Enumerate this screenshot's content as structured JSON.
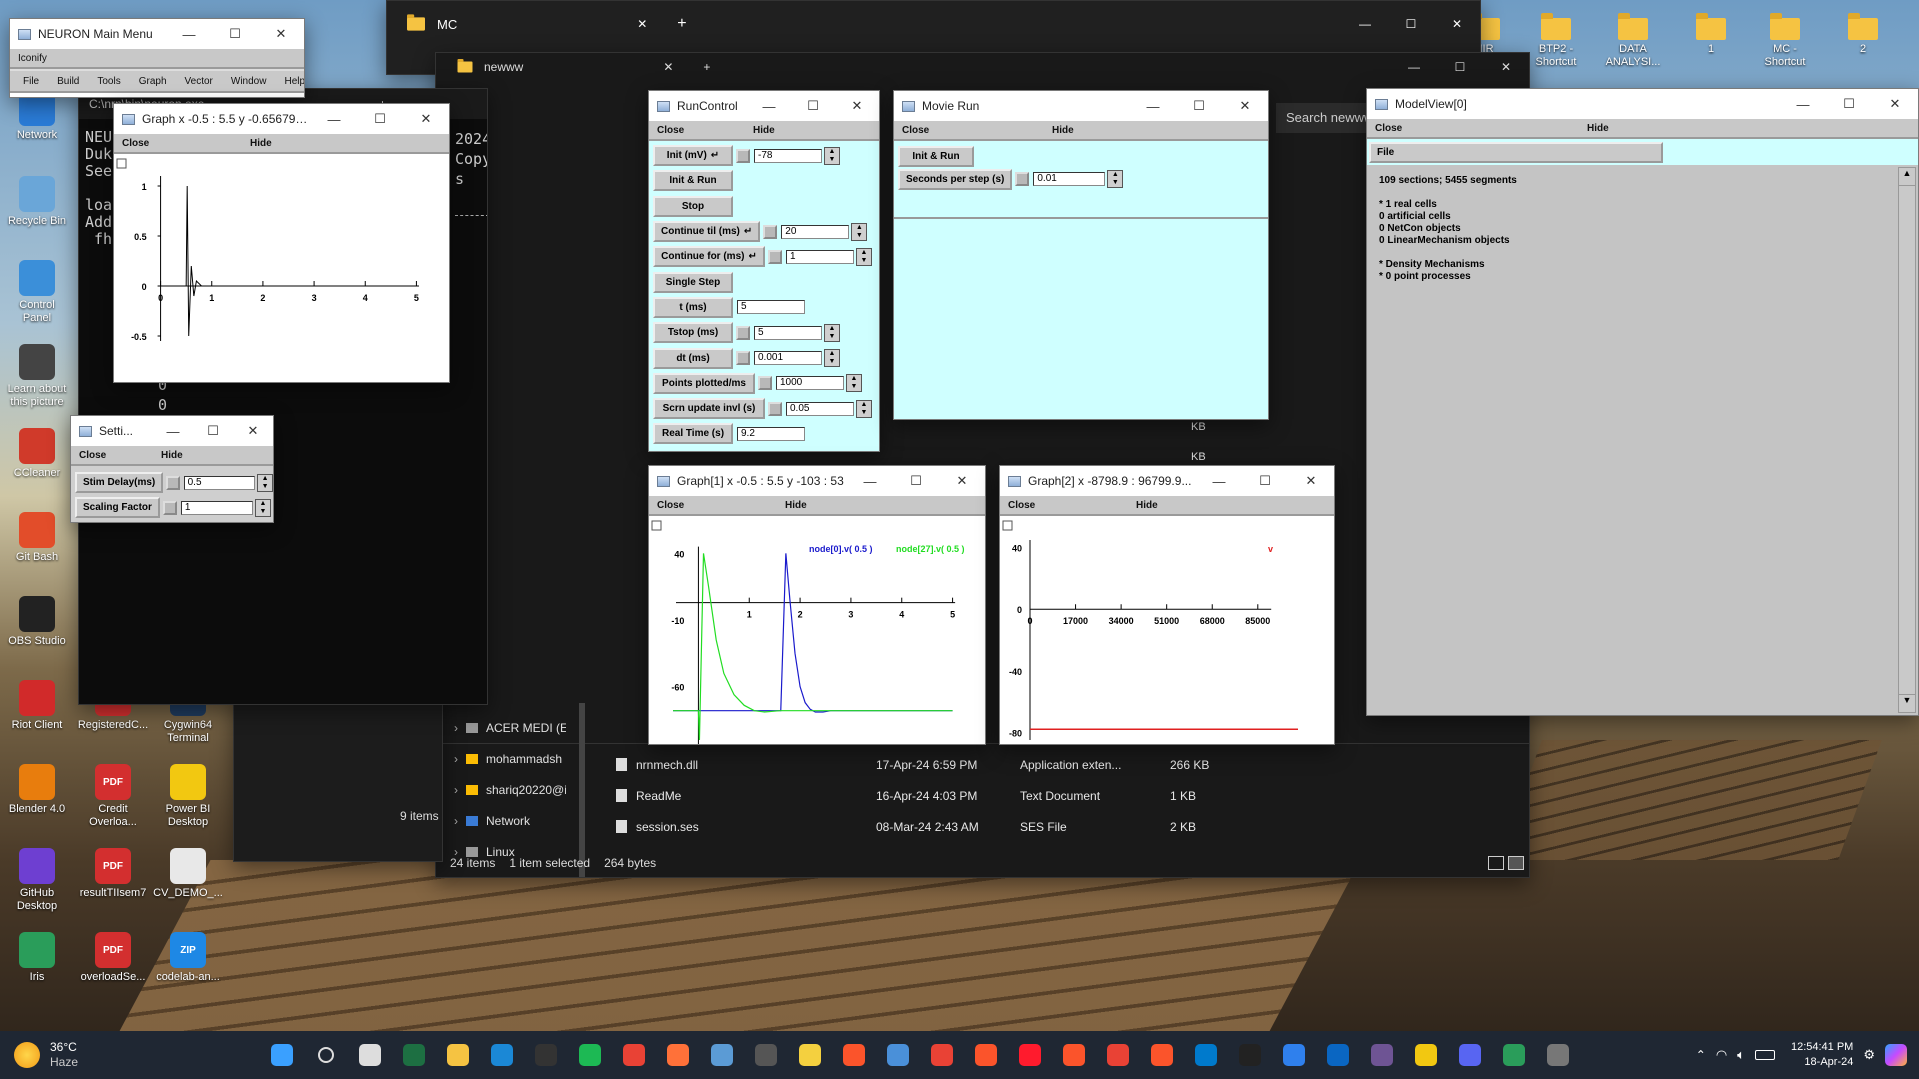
{
  "desktop": {
    "left_icons": [
      {
        "label": "Network",
        "icon": "network-icon"
      },
      {
        "label": "Recycle Bin",
        "icon": "recycle-bin-icon"
      },
      {
        "label": "Control Panel",
        "icon": "control-panel-icon"
      },
      {
        "label": "Learn about this picture",
        "icon": "camera-icon"
      },
      {
        "label": "CCleaner",
        "icon": "ccleaner-icon"
      },
      {
        "label": "Git Bash",
        "icon": "git-icon"
      },
      {
        "label": "OBS Studio",
        "icon": "obs-icon"
      },
      {
        "label": "Riot Client",
        "icon": "riot-icon"
      },
      {
        "label": "Blender 4.0",
        "icon": "blender-icon"
      },
      {
        "label": "GitHub Desktop",
        "icon": "github-icon"
      },
      {
        "label": "Iris",
        "icon": "iris-icon"
      }
    ],
    "mid_icons": [
      {
        "label": "RegisteredC...",
        "icon": "pdf-icon"
      },
      {
        "label": "Cygwin64 Terminal",
        "icon": "terminal-icon"
      },
      {
        "label": "Credit Overloa...",
        "icon": "pdf-icon"
      },
      {
        "label": "Power BI Desktop",
        "icon": "powerbi-icon"
      },
      {
        "label": "resultTIIsem7",
        "icon": "pdf-icon"
      },
      {
        "label": "CV_DEMO_...",
        "icon": "document-icon"
      },
      {
        "label": "overloadSe...",
        "icon": "pdf-icon"
      },
      {
        "label": "codelab-an...",
        "icon": "zip-icon"
      }
    ],
    "top_right_icons": [
      {
        "label": "IIIR",
        "icon": "folder-icon"
      },
      {
        "label": "BTP2 - Shortcut",
        "icon": "folder-shortcut-icon"
      },
      {
        "label": "DATA ANALYSI...",
        "icon": "folder-shortcut-icon"
      },
      {
        "label": "1",
        "icon": "folder-icon"
      },
      {
        "label": "MC - Shortcut",
        "icon": "folder-shortcut-icon"
      },
      {
        "label": "2",
        "icon": "folder-icon"
      }
    ]
  },
  "mc_window": {
    "title": "MC",
    "tab2_title": "newww",
    "search_placeholder": "Search newww"
  },
  "explorer": {
    "nav": [
      {
        "label": "ACER MEDI (E:",
        "icon": "drive-icon"
      },
      {
        "label": "mohammadsh",
        "icon": "gdrive-icon"
      },
      {
        "label": "shariq20220@i",
        "icon": "gdrive-icon"
      },
      {
        "label": "Network",
        "icon": "network-icon"
      },
      {
        "label": "Linux",
        "icon": "linux-icon"
      }
    ],
    "items_count_side": "9 items",
    "files": [
      {
        "name": "nrnmech.dll",
        "date": "17-Apr-24 6:59 PM",
        "type": "Application exten...",
        "size": "266 KB"
      },
      {
        "name": "ReadMe",
        "date": "16-Apr-24 4:03 PM",
        "type": "Text Document",
        "size": "1 KB"
      },
      {
        "name": "session.ses",
        "date": "08-Mar-24 2:43 AM",
        "type": "SES File",
        "size": "2 KB"
      }
    ],
    "status": {
      "items": "24 items",
      "selected": "1 item selected",
      "bytes": "264 bytes"
    },
    "kb_fragments": [
      "KB",
      "KB"
    ]
  },
  "terminal": {
    "tab_title": "C:\\nrn\\bin\\neuron.exe",
    "lines": [
      "NEU",
      "Duk",
      "See",
      "",
      "loa",
      "Add",
      " fh"
    ],
    "right_lines": [
      "2024-02-09",
      "Copyright 1984-2022",
      "s"
    ],
    "zeros": [
      "0",
      "0"
    ]
  },
  "neuron_main": {
    "title": "NEURON Main Menu",
    "iconify": "Iconify",
    "menu": [
      "File",
      "Build",
      "Tools",
      "Graph",
      "Vector",
      "Window",
      "Help"
    ]
  },
  "graph0": {
    "title": "Graph  x -0.5 : 5.5  y -0.656794...",
    "close": "Close",
    "hide": "Hide",
    "y_ticks": [
      "1",
      "0.5",
      "0",
      "-0.5"
    ],
    "x_ticks": [
      "0",
      "1",
      "2",
      "3",
      "4",
      "5"
    ]
  },
  "settings": {
    "title": "Setti...",
    "close": "Close",
    "hide": "Hide",
    "rows": [
      {
        "label": "Stim Delay(ms)",
        "value": "0.5"
      },
      {
        "label": "Scaling Factor",
        "value": "1"
      }
    ]
  },
  "runcontrol": {
    "title": "RunControl",
    "close": "Close",
    "hide": "Hide",
    "rows": [
      {
        "label": "Init (mV)",
        "arrow": true,
        "value": "-78",
        "check": true,
        "spin": true
      },
      {
        "label": "Init & Run",
        "arrow": false,
        "value": null
      },
      {
        "label": "Stop",
        "arrow": false,
        "value": null
      },
      {
        "label": "Continue til (ms)",
        "arrow": true,
        "value": "20",
        "check": true,
        "spin": true
      },
      {
        "label": "Continue for (ms)",
        "arrow": true,
        "value": "1",
        "check": true,
        "spin": true
      },
      {
        "label": "Single Step",
        "arrow": false,
        "value": null
      },
      {
        "label": "t (ms)",
        "arrow": false,
        "value": "5",
        "check": false,
        "spin": false
      },
      {
        "label": "Tstop (ms)",
        "arrow": false,
        "value": "5",
        "check": true,
        "spin": true
      },
      {
        "label": "dt (ms)",
        "arrow": false,
        "value": "0.001",
        "check": true,
        "spin": true
      },
      {
        "label": "Points plotted/ms",
        "arrow": false,
        "value": "1000",
        "check": true,
        "spin": true
      },
      {
        "label": "Scrn update invl (s)",
        "arrow": false,
        "value": "0.05",
        "check": true,
        "spin": true
      },
      {
        "label": "Real Time (s)",
        "arrow": false,
        "value": "9.2",
        "check": false,
        "spin": false
      }
    ]
  },
  "movierun": {
    "title": "Movie Run",
    "close": "Close",
    "hide": "Hide",
    "init_run": "Init & Run",
    "seconds_label": "Seconds per step (s)",
    "seconds_value": "0.01"
  },
  "modelview": {
    "title": "ModelView[0]",
    "close": "Close",
    "hide": "Hide",
    "file": "File",
    "lines": [
      "109 sections; 5455 segments",
      "",
      "* 1 real cells",
      "0 artificial cells",
      "0 NetCon objects",
      "0 LinearMechanism objects",
      "",
      "* Density Mechanisms",
      "* 0 point processes"
    ]
  },
  "graph1": {
    "title": "Graph[1]  x -0.5 : 5.5  y -103 : 53",
    "close": "Close",
    "hide": "Hide",
    "y_ticks": [
      "40",
      "-10",
      "-60"
    ],
    "x_ticks": [
      "1",
      "2",
      "3",
      "4",
      "5"
    ],
    "legend": [
      {
        "label": "node[0].v( 0.5 )",
        "color": "#1a1acc"
      },
      {
        "label": "node[27].v( 0.5 )",
        "color": "#22dd22"
      }
    ]
  },
  "graph2": {
    "title": "Graph[2]  x -8798.9 : 96799.9...",
    "close": "Close",
    "hide": "Hide",
    "y_ticks": [
      "40",
      "0",
      "-40",
      "-80"
    ],
    "x_ticks": [
      "0",
      "17000",
      "34000",
      "51000",
      "68000",
      "85000"
    ],
    "marker": "v",
    "line_color": "#e02020"
  },
  "chart_data": [
    {
      "type": "line",
      "chart": "Graph",
      "xlim": [
        -0.5,
        5.5
      ],
      "series": [
        {
          "x": [
            0.0,
            0.5,
            0.52,
            0.55,
            0.6,
            0.65,
            0.7,
            0.8,
            1.0,
            5.0
          ],
          "y": [
            0.0,
            0.0,
            1.0,
            -0.5,
            0.2,
            -0.1,
            0.05,
            0.0,
            0.0,
            0.0
          ]
        }
      ]
    },
    {
      "type": "line",
      "chart": "Graph[1]",
      "xlim": [
        -0.5,
        5.5
      ],
      "ylim": [
        -103,
        53
      ],
      "series": [
        {
          "name": "node[0].v( 0.5 )",
          "color": "#1a1acc",
          "x": [
            -0.5,
            1.5,
            1.62,
            1.72,
            1.8,
            1.9,
            2.0,
            2.1,
            2.2,
            2.3,
            2.45,
            2.6,
            5.0
          ],
          "y": [
            -78,
            -78,
            -78,
            40,
            5,
            -35,
            -60,
            -72,
            -77,
            -79,
            -79,
            -78,
            -78
          ]
        },
        {
          "name": "node[27].v( 0.5 )",
          "color": "#22dd22",
          "x": [
            -0.5,
            0.0,
            0.02,
            0.1,
            0.2,
            0.35,
            0.5,
            0.7,
            0.9,
            1.1,
            1.3,
            1.6,
            5.0
          ],
          "y": [
            -78,
            -78,
            -100,
            40,
            15,
            -25,
            -50,
            -66,
            -74,
            -78,
            -79,
            -78,
            -78
          ]
        }
      ]
    },
    {
      "type": "line",
      "chart": "Graph[2]",
      "xlim": [
        -8798.9,
        96799.9
      ],
      "series": [
        {
          "color": "#e02020",
          "x": [
            0,
            100000
          ],
          "y": [
            -78,
            -78
          ]
        }
      ]
    }
  ],
  "taskbar": {
    "weather_temp": "36°C",
    "weather_desc": "Haze",
    "time": "12:54:41 PM",
    "date": "18-Apr-24",
    "apps": [
      "start-icon",
      "search-icon",
      "task-view-icon",
      "excel-icon",
      "explorer-icon",
      "edge-icon",
      "terminal-icon",
      "spotify-icon",
      "chrome-icon",
      "firefox-icon",
      "photos-icon",
      "calculator-icon",
      "notes-icon",
      "brave-icon",
      "notepad-icon",
      "chrome-icon",
      "brave-icon",
      "opera-icon",
      "brave-icon",
      "chrome-icon",
      "brave-icon",
      "vscode-icon",
      "tradingview-icon",
      "app-icon",
      "linkedin-icon",
      "github-icon",
      "powerbi-icon",
      "discord-icon",
      "iris-icon",
      "neuron-icon"
    ]
  }
}
